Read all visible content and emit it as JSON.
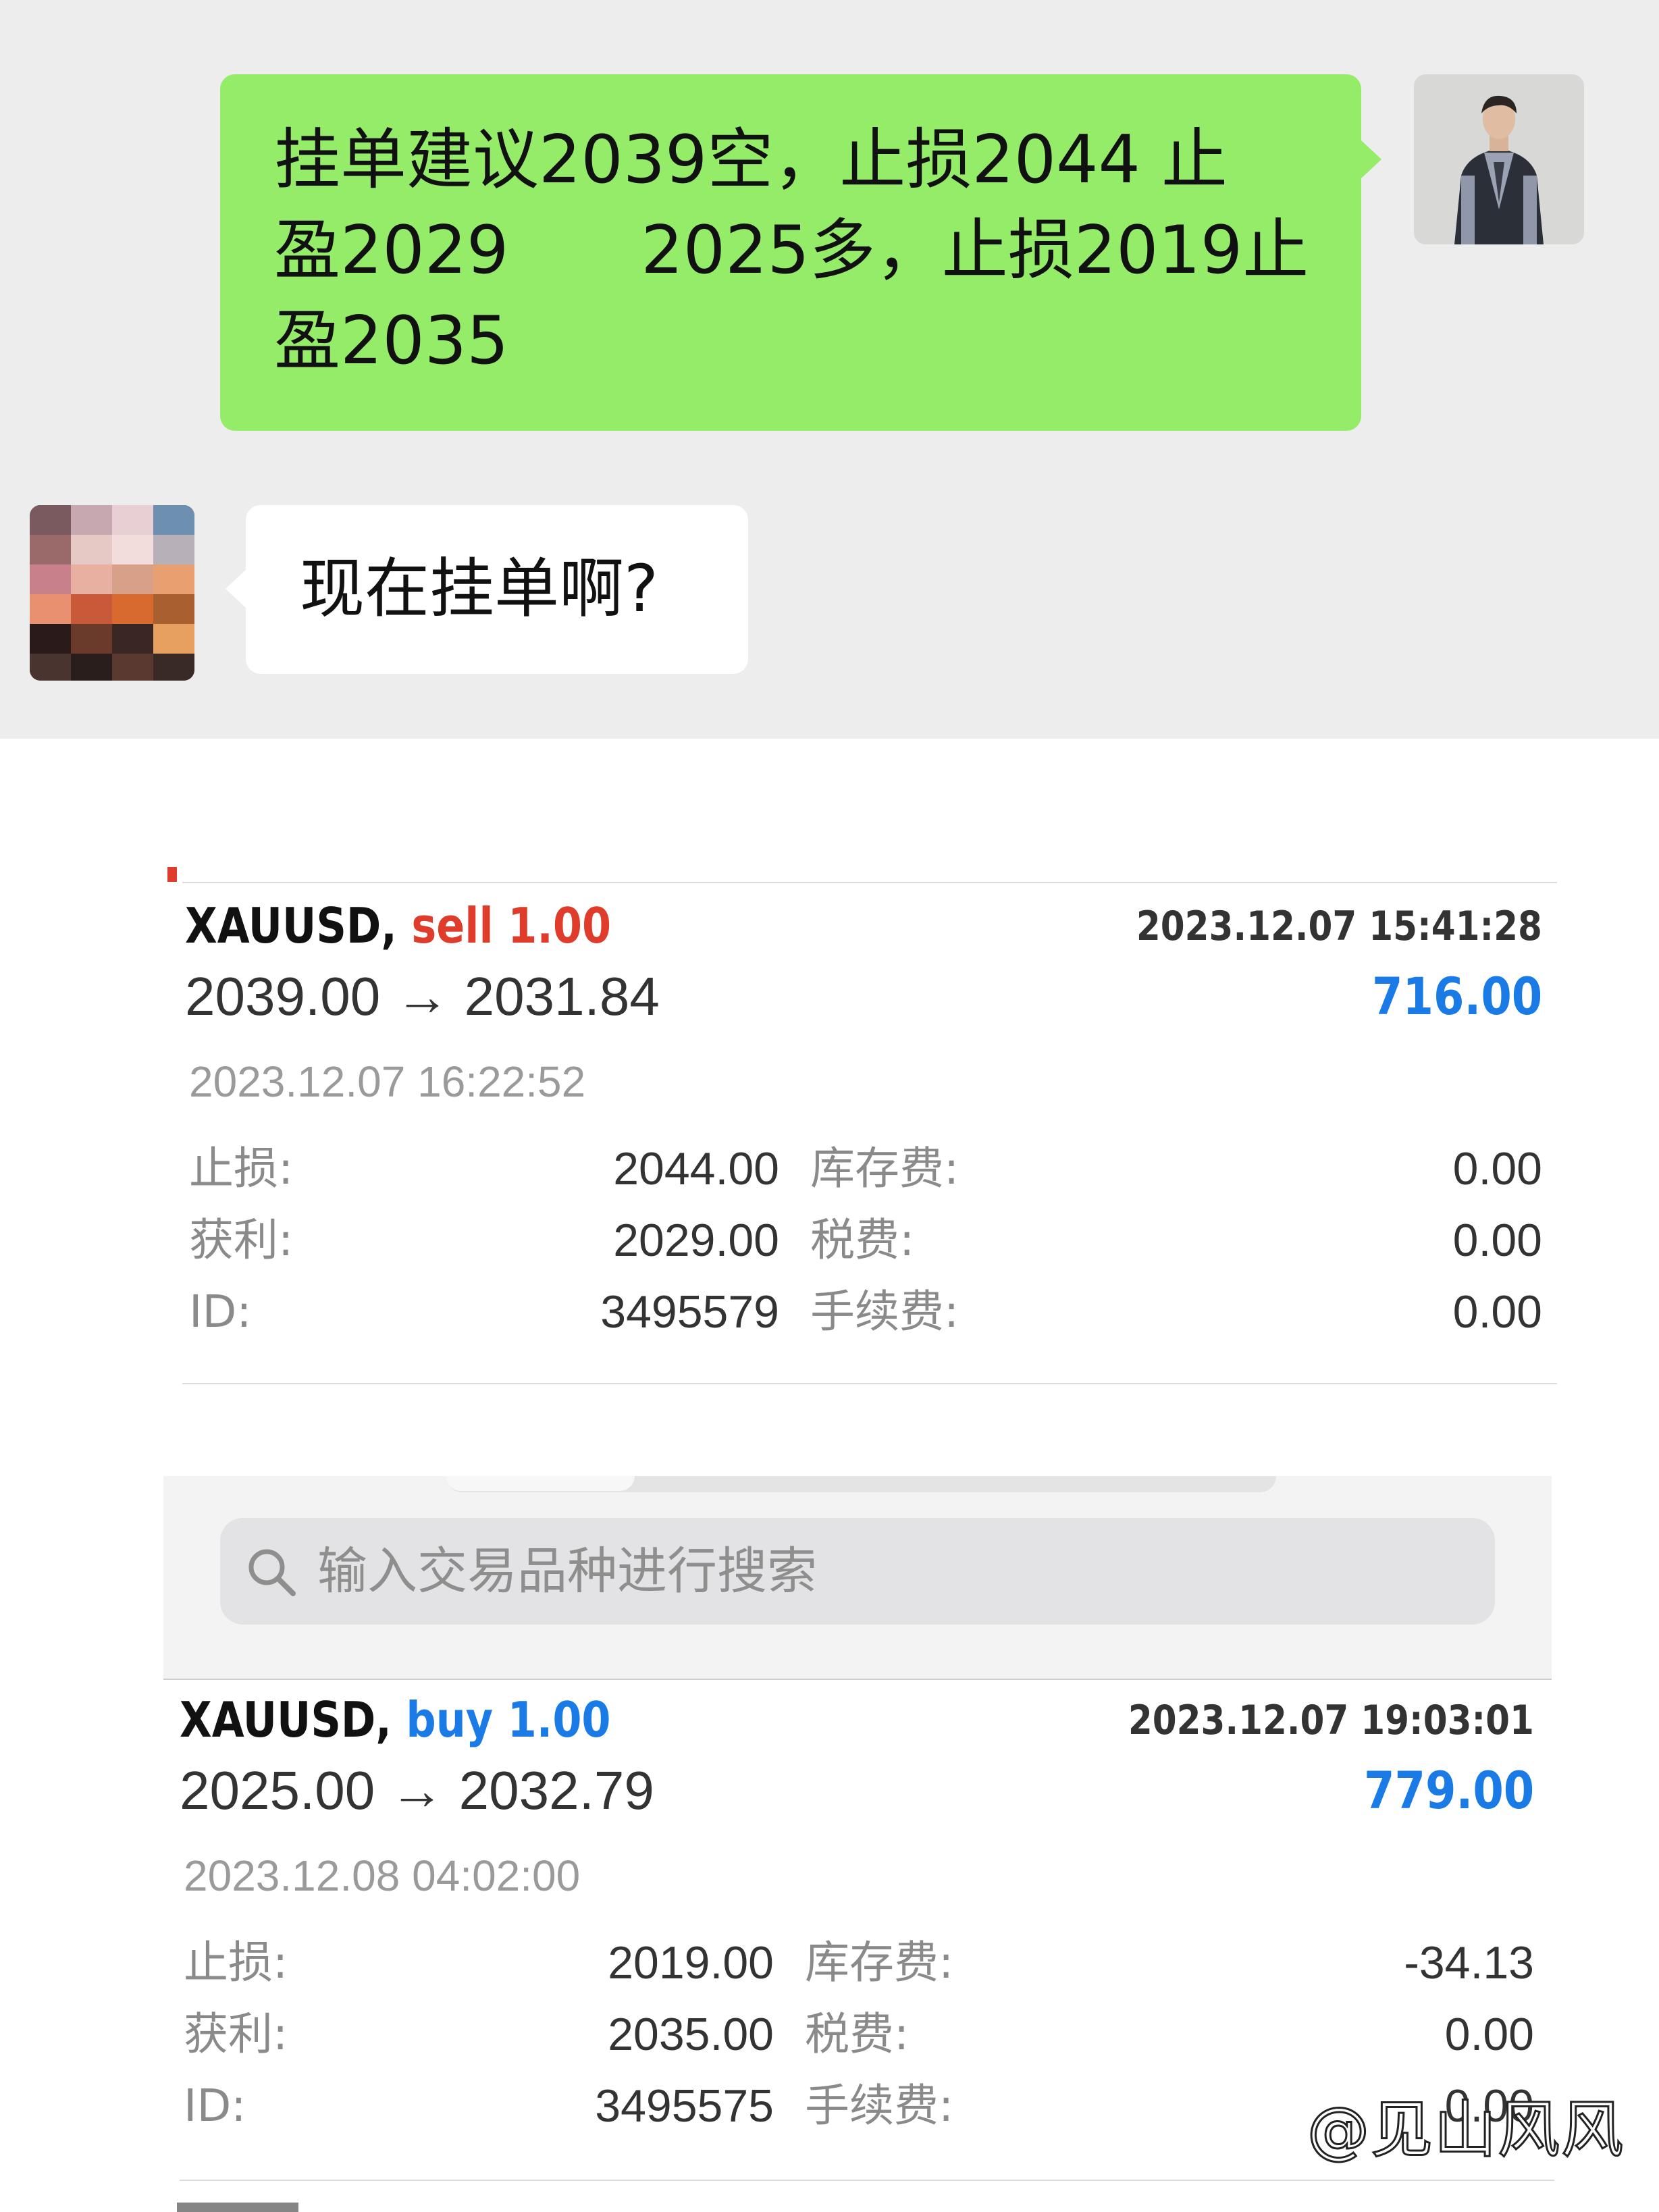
{
  "chat": {
    "outgoing_lines": [
      "挂单建议2039空，止损2044 止",
      "盈2029　　2025多，止损2019止",
      "盈2035"
    ],
    "incoming_text": "现在挂单啊?"
  },
  "trades": [
    {
      "symbol": "XAUUSD,",
      "side": "sell 1.00",
      "open_time": "2023.12.07 15:41:28",
      "prices": "2039.00 → 2031.84",
      "profit": "716.00",
      "close_time": "2023.12.07 16:22:52",
      "rows": [
        {
          "label": "止损:",
          "value": "2044.00",
          "label2": "库存费:",
          "value2": "0.00"
        },
        {
          "label": "获利:",
          "value": "2029.00",
          "label2": "税费:",
          "value2": "0.00"
        },
        {
          "label": "ID:",
          "value": "3495579",
          "label2": "手续费:",
          "value2": "0.00"
        }
      ]
    },
    {
      "symbol": "XAUUSD,",
      "side": "buy 1.00",
      "open_time": "2023.12.07 19:03:01",
      "prices": "2025.00 → 2032.79",
      "profit": "779.00",
      "close_time": "2023.12.08 04:02:00",
      "rows": [
        {
          "label": "止损:",
          "value": "2019.00",
          "label2": "库存费:",
          "value2": "-34.13"
        },
        {
          "label": "获利:",
          "value": "2035.00",
          "label2": "税费:",
          "value2": "0.00"
        },
        {
          "label": "ID:",
          "value": "3495575",
          "label2": "手续费:",
          "value2": "0.00"
        }
      ]
    }
  ],
  "search": {
    "placeholder": "输入交易品种进行搜索"
  },
  "watermark": "@见山风风",
  "colors": {
    "chat_bg": "#ededed",
    "outgoing_bubble": "#95ec69",
    "sell": "#e03c2c",
    "buy_profit": "#1a7be6"
  }
}
